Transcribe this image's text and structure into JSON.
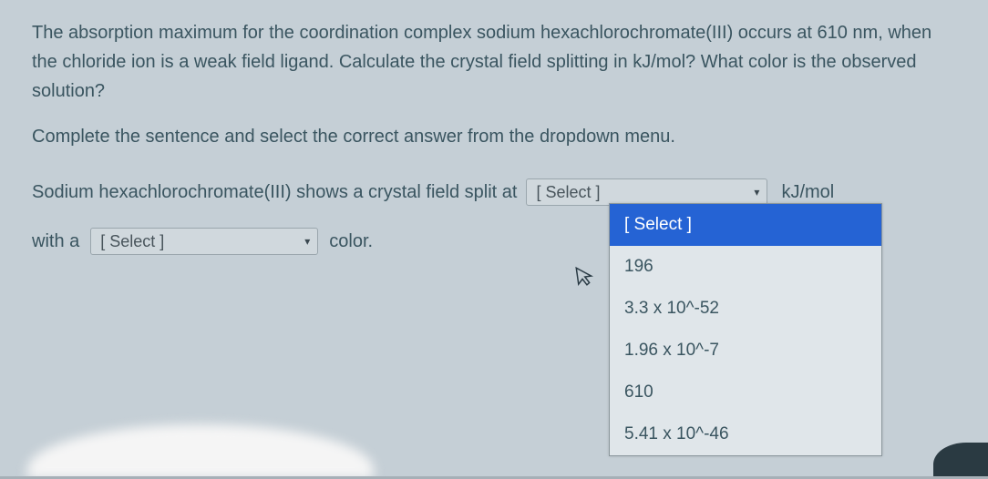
{
  "question": {
    "paragraph": "The absorption maximum for the coordination complex sodium hexachlorochromate(III) occurs at 610 nm, when the chloride ion is a weak field ligand. Calculate the crystal field splitting in kJ/mol? What color is the observed solution?",
    "instruction": "Complete the sentence and select the correct answer from the dropdown menu."
  },
  "sentence1": {
    "prefix": "Sodium hexachlorochromate(III) shows a crystal field split at",
    "dropdown_value": "[ Select ]",
    "unit": "kJ/mol"
  },
  "sentence2": {
    "prefix": "with a",
    "dropdown_value": "[ Select ]",
    "suffix": "color."
  },
  "dropdown1_options": {
    "header": "[ Select ]",
    "items": [
      "196",
      "3.3 x 10^-52",
      "1.96 x 10^-7",
      "610",
      "5.41 x 10^-46"
    ]
  }
}
